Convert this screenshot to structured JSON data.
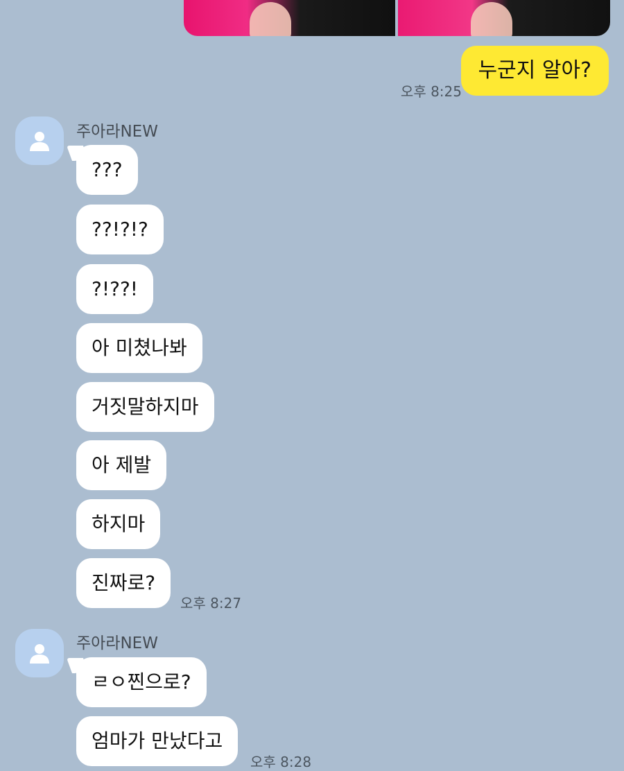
{
  "colors": {
    "background": "#abbdd0",
    "outgoing_bubble": "#fee933",
    "incoming_bubble": "#ffffff",
    "avatar": "#b7d0ee"
  },
  "outgoing": {
    "text": "누군지 알아?",
    "time": "오후 8:25"
  },
  "groups": [
    {
      "sender": "주아라NEW",
      "messages": [
        "???",
        "??!?!?",
        "?!??!",
        "아 미쳤나봐",
        "거짓말하지마",
        "아 제발",
        "하지마",
        "진짜로?"
      ],
      "time": "오후 8:27"
    },
    {
      "sender": "주아라NEW",
      "messages": [
        "ㄹㅇ찐으로?",
        "엄마가 만났다고"
      ],
      "time": "오후 8:28"
    }
  ],
  "avatar_icon": "default-profile-icon"
}
